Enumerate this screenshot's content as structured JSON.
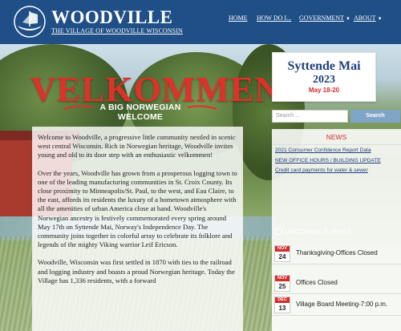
{
  "header": {
    "title": "WOODVILLE",
    "subtitle": "THE VILLAGE OF WOODVILLE WISCONSIN",
    "nav": [
      {
        "label": "HOME"
      },
      {
        "label": "HOW DO I..."
      },
      {
        "label": "GOVERNMENT"
      },
      {
        "label": "ABOUT"
      }
    ]
  },
  "hero": {
    "heading": "VELKOMMEN",
    "subline1": "A BIG NORWEGIAN",
    "subline2": "WELCOME"
  },
  "content": {
    "paragraphs": [
      "Welcome to Woodville, a progressive little community nestled in scenic west central Wisconsin. Rich in Norwegian heritage, Woodville invites young and old to its door step with an enthusiastic velkommen!",
      "Over the years, Woodville has grown from a prosperous logging town to one of the leading manufacturing communities in St. Croix County. Its close proximity to Minneapolis/St. Paul, to the west, and Eau Claire, to the east, affords its residents the luxury of a hometown atmosphere with all the amenities of urban America close at hand. Woodville's Norwegian ancestry is festively commemorated every spring around May 17th on Syttende Mai, Norway's Independence Day. The community joins together in colorful array to celebrate its folklore and legends of the mighty Viking warrior Leif Ericson.",
      "Woodville, Wisconsin was first settled in 1870 with ties to the railroad and logging industry and boasts a proud Norwegian heritage. Today the Village has 1,336 residents, with a forward"
    ]
  },
  "sidebar": {
    "ad": {
      "title": "Syttende Mai",
      "year": "2023",
      "dates": "May 18-20"
    },
    "search": {
      "placeholder": "Search ...",
      "button": "Search"
    },
    "news": {
      "heading": "NEWS",
      "items": [
        "2021 Consumer Confidence Report Data",
        "NEW OFFICE HOURS / BUILDING UPDATE",
        "Credit card payments for water & sewer"
      ]
    },
    "events": {
      "heading": "UPCOMING EVENTS",
      "items": [
        {
          "month": "NOV",
          "day": "24",
          "title": "Thanksgiving-Offices Closed"
        },
        {
          "month": "NOV",
          "day": "25",
          "title": "Offices Closed"
        },
        {
          "month": "DEC",
          "day": "13",
          "title": "Village Board Meeting-7:00 p.m."
        }
      ]
    }
  },
  "colors": {
    "header_bg": "#1f4f86",
    "accent_red": "#d22d2a",
    "welcome_red": "#e0302a",
    "search_button": "#7fa6c6"
  }
}
